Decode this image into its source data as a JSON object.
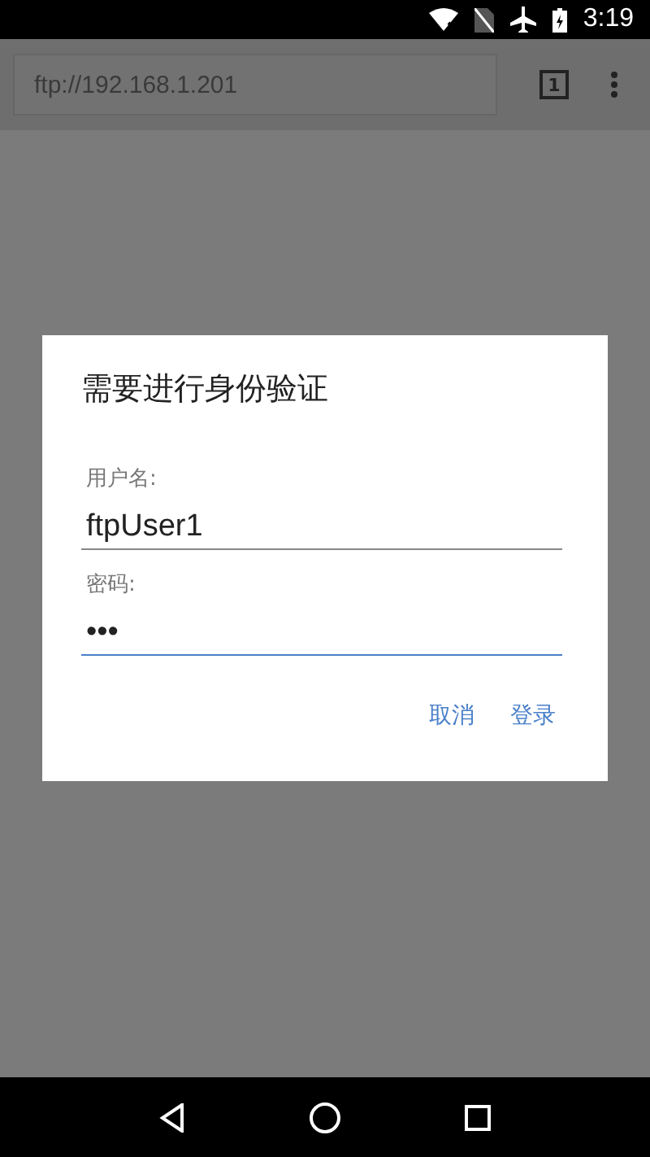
{
  "status_bar": {
    "time": "3:19"
  },
  "browser_toolbar": {
    "url": "ftp://192.168.1.201",
    "tab_count": "1"
  },
  "dialog": {
    "title": "需要进行身份验证",
    "fields": [
      {
        "label": "用户名:",
        "value": "ftpUser1",
        "focused": false
      },
      {
        "label": "密码:",
        "value": "•••",
        "focused": true
      }
    ],
    "buttons": [
      "取消",
      "登录"
    ]
  }
}
